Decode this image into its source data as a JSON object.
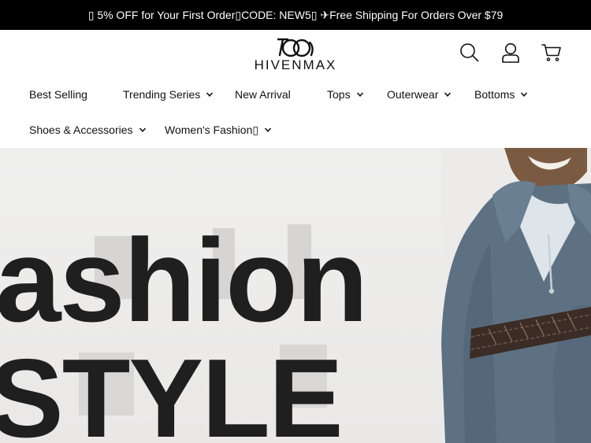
{
  "announcement": "▯ 5% OFF for Your First Order▯CODE: NEW5▯ ✈Free Shipping For Orders Over $79",
  "brand": {
    "name": "HIVENMAX"
  },
  "header_icons": [
    "search-icon",
    "account-icon",
    "cart-icon"
  ],
  "nav": {
    "items": [
      {
        "label": "Best Selling",
        "has_dropdown": false
      },
      {
        "label": "Trending Series",
        "has_dropdown": true
      },
      {
        "label": "New Arrival",
        "has_dropdown": false
      },
      {
        "label": "Tops",
        "has_dropdown": true
      },
      {
        "label": "Outerwear",
        "has_dropdown": true
      },
      {
        "label": "Bottoms",
        "has_dropdown": true
      },
      {
        "label": "Shoes & Accessories",
        "has_dropdown": true
      },
      {
        "label": "Women's Fashion▯",
        "has_dropdown": true
      }
    ]
  },
  "hero": {
    "line1": "ashion",
    "line2": "STYLE"
  },
  "colors": {
    "announcement_bg": "#000000",
    "text": "#111111",
    "hero_text": "#1f1f1f",
    "jacket": "#5d7183"
  }
}
